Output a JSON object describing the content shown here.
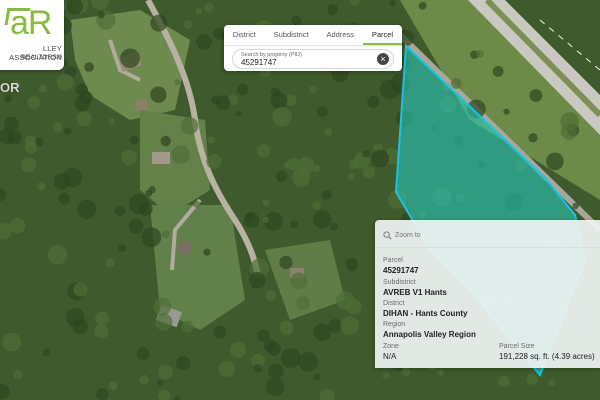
{
  "logo": {
    "mark": "aR",
    "line1": "LLEY ASSOCIATION",
    "line2": "REALTORS®",
    "side_text": "OR"
  },
  "search": {
    "tabs": [
      {
        "label": "District",
        "active": false
      },
      {
        "label": "Subdistrict",
        "active": false
      },
      {
        "label": "Address",
        "active": false
      },
      {
        "label": "Parcel",
        "active": true
      }
    ],
    "placeholder": "Search by property (PID)",
    "value": "45291747",
    "clear_icon": "close-icon"
  },
  "info": {
    "zoom_label": "Zoom to",
    "zoom_icon": "search-icon",
    "parcel_label": "Parcel",
    "parcel_value": "45291747",
    "subdistrict_label": "Subdistrict",
    "subdistrict_value": "AVREB V1 Hants",
    "district_label": "District",
    "district_value": "DIHAN - Hants County",
    "region_label": "Region",
    "region_value": "Annapolis Valley Region",
    "zone_label": "Zone",
    "zone_value": "N/A",
    "size_label": "Parcel Size",
    "size_value": "191,228 sq. ft. (4.39 acres)"
  },
  "colors": {
    "parcel_fill": "#25d1c6",
    "parcel_stroke": "#16c4e3",
    "brand_green": "#86bd3f",
    "forest": "#3f5a2c",
    "road": "#a9a79a"
  }
}
